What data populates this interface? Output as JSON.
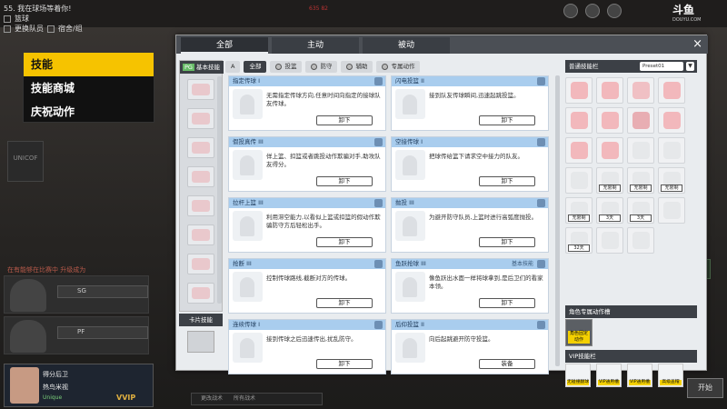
{
  "left_info": {
    "line1": "55. 我在球场等着你!",
    "line2": "篮球",
    "line3": "更换队员",
    "line4": "宿舍/组"
  },
  "menu": [
    {
      "label": "技能"
    },
    {
      "label": "技能商城"
    },
    {
      "label": "庆祝动作"
    }
  ],
  "left_logo": "UNICOF",
  "red_text": "在有能够在比赛中 升级成为",
  "player_slots": [
    {
      "drop": "SG"
    },
    {
      "drop": "PF"
    }
  ],
  "bottom_player": {
    "role": "得分后卫",
    "name": "热鸟米视",
    "rank": "Unique",
    "vip": "VVIP"
  },
  "dialog": {
    "tabs": [
      "全部",
      "主动",
      "被动"
    ],
    "close": "×",
    "left_panel": {
      "head_badge": "PG",
      "head": "基本技能",
      "card_head": "卡片技能"
    },
    "filters": [
      {
        "label": "A",
        "kind": "letter"
      },
      {
        "label": "全部"
      },
      {
        "label": "投篮"
      },
      {
        "label": "防守"
      },
      {
        "label": "辅助"
      },
      {
        "label": "专属动作"
      }
    ],
    "skills": [
      {
        "title": "指定传球 I",
        "desc": "无需指定传球方向,任意时间向指定的接球队友传球。",
        "button": "卸下",
        "tag": ""
      },
      {
        "title": "闪电投篮 II",
        "desc": "接到队友传球瞬间,迅速起跳投篮。",
        "button": "卸下",
        "tag": ""
      },
      {
        "title": "假投真传 III",
        "desc": "佯上篮、扣篮或者跳投动作欺骗对手,助攻队友得分。",
        "button": "卸下",
        "tag": ""
      },
      {
        "title": "空接传球 I",
        "desc": "把球传给篮下请求空中接力的队友。",
        "button": "卸下",
        "tag": ""
      },
      {
        "title": "拉杆上篮 III",
        "desc": "利用滞空能力,以看似上篮或扣篮的假动作欺骗防守方后轻松出手。",
        "button": "卸下",
        "tag": ""
      },
      {
        "title": "抛投 III",
        "desc": "为避开防守队员,上篮时进行高弧度抛投。",
        "button": "卸下",
        "tag": ""
      },
      {
        "title": "抢断 III",
        "desc": "控制传球路线,截断对方的传球。",
        "button": "卸下",
        "tag": ""
      },
      {
        "title": "鱼跃抢球 III",
        "desc": "像鱼跃出水面一样将球拿到,是后卫们的看家本领。",
        "button": "卸下",
        "tag": "基本技能"
      },
      {
        "title": "连续传球 I",
        "desc": "接到传球之后迅速传出,扰乱防守。",
        "button": "卸下",
        "tag": ""
      },
      {
        "title": "后仰投篮 II",
        "desc": "向后起跳避开防守投篮。",
        "button": "装备",
        "tag": ""
      }
    ],
    "right_panel": {
      "head": "普通技能栏",
      "select": "Preset01",
      "select_arrow": "▼",
      "item_labels": [
        "无限制",
        "无限制",
        "无限制",
        "无限制",
        "3天",
        "3天",
        "32天"
      ],
      "role_head": "角色专属动作槽",
      "role_label": "角色固定动作",
      "vip_head": "VIP技能栏",
      "vip_labels": [
        "无碰撞翻球",
        "VIP通用槽",
        "VIP通用槽",
        "高级盖帽"
      ]
    }
  },
  "chat": {
    "label": "更改战术",
    "value": "所有战术"
  },
  "corner_button": "开始",
  "brand": {
    "name": "斗鱼",
    "sub": "DOUYU.COM"
  },
  "score": "635 82"
}
